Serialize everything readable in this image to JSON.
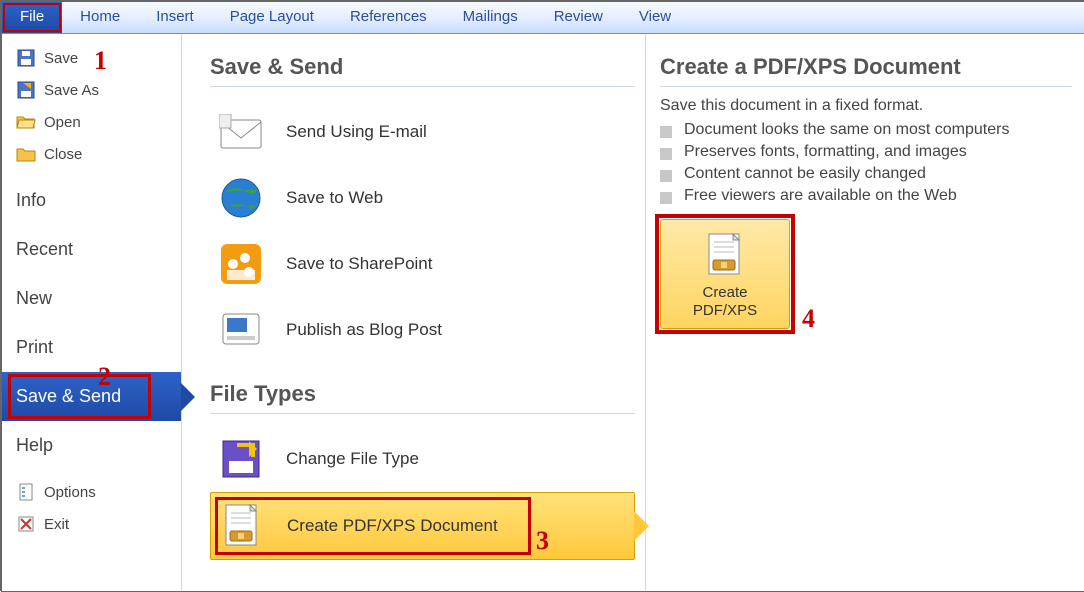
{
  "ribbon": {
    "tabs": [
      "File",
      "Home",
      "Insert",
      "Page Layout",
      "References",
      "Mailings",
      "Review",
      "View"
    ],
    "active_index": 0
  },
  "nav": {
    "items": [
      {
        "id": "save",
        "label": "Save",
        "icon": "save"
      },
      {
        "id": "saveas",
        "label": "Save As",
        "icon": "saveas"
      },
      {
        "id": "open",
        "label": "Open",
        "icon": "folder-open"
      },
      {
        "id": "close",
        "label": "Close",
        "icon": "folder-close"
      },
      {
        "id": "info",
        "label": "Info",
        "big": true
      },
      {
        "id": "recent",
        "label": "Recent",
        "big": true
      },
      {
        "id": "new",
        "label": "New",
        "big": true
      },
      {
        "id": "print",
        "label": "Print",
        "big": true
      },
      {
        "id": "save-send",
        "label": "Save & Send",
        "big": true,
        "selected": true
      },
      {
        "id": "help",
        "label": "Help",
        "big": true
      },
      {
        "id": "options",
        "label": "Options",
        "icon": "options"
      },
      {
        "id": "exit",
        "label": "Exit",
        "icon": "exit"
      }
    ]
  },
  "center": {
    "section1_title": "Save & Send",
    "section1_options": [
      {
        "id": "send-email",
        "label": "Send Using E-mail",
        "icon": "mail"
      },
      {
        "id": "save-web",
        "label": "Save to Web",
        "icon": "globe"
      },
      {
        "id": "save-sharepoint",
        "label": "Save to SharePoint",
        "icon": "sharepoint"
      },
      {
        "id": "publish-blog",
        "label": "Publish as Blog Post",
        "icon": "blog"
      }
    ],
    "section2_title": "File Types",
    "section2_options": [
      {
        "id": "change-file-type",
        "label": "Change File Type",
        "icon": "change-type"
      },
      {
        "id": "create-pdfxps",
        "label": "Create PDF/XPS Document",
        "icon": "pdfxps",
        "selected": true
      }
    ]
  },
  "detail": {
    "title": "Create a PDF/XPS Document",
    "intro": "Save this document in a fixed format.",
    "bullets": [
      "Document looks the same on most computers",
      "Preserves fonts, formatting, and images",
      "Content cannot be easily changed",
      "Free viewers are available on the Web"
    ],
    "button_line1": "Create",
    "button_line2": "PDF/XPS"
  },
  "annotations": {
    "a1": "1",
    "a2": "2",
    "a3": "3",
    "a4": "4"
  }
}
